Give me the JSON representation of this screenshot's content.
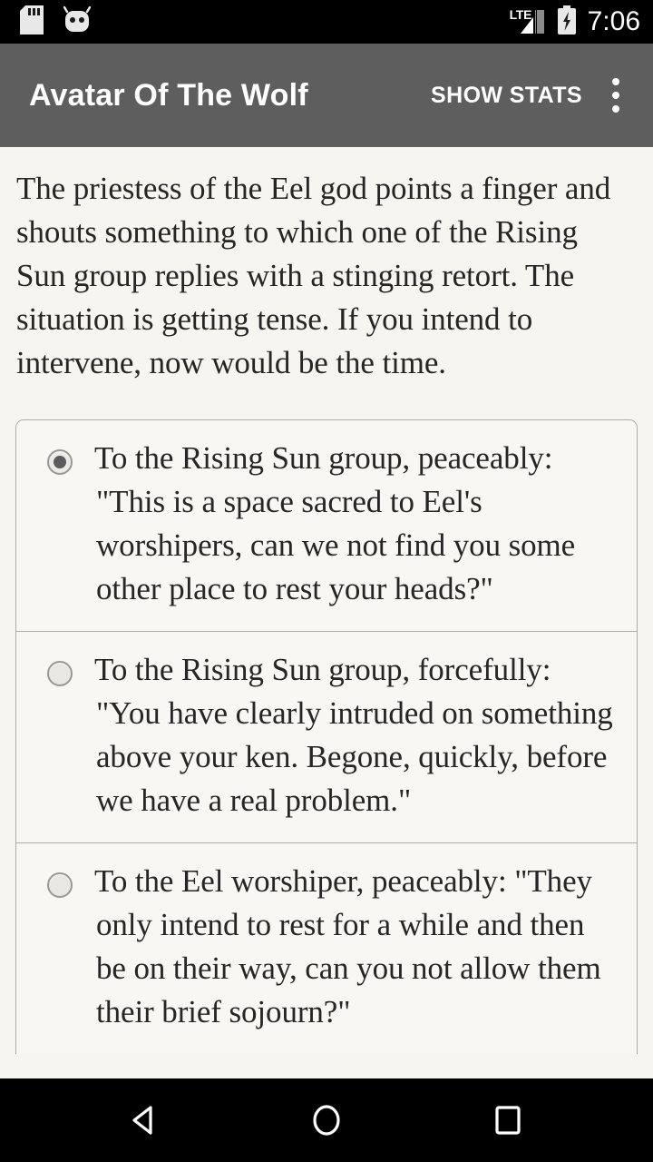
{
  "status_bar": {
    "icons": [
      "sd-card-icon",
      "android-head-icon"
    ],
    "network_label": "LTE",
    "signal_icon": "signal-bars-icon",
    "battery_icon": "battery-charging-icon",
    "time": "7:06"
  },
  "app_bar": {
    "title": "Avatar Of The Wolf",
    "show_stats_label": "SHOW STATS",
    "overflow_icon": "overflow-menu-icon"
  },
  "story": {
    "text": "The priestess of the Eel god points a finger and shouts something to which one of the Rising Sun group replies with a stinging retort. The situation is getting tense. If you intend to intervene, now would be the time."
  },
  "choices": [
    {
      "selected": true,
      "text": "To the Rising Sun group, peaceably: \"This is a space sacred to Eel's worshipers, can we not find you some other place to rest your heads?\""
    },
    {
      "selected": false,
      "text": "To the Rising Sun group, forcefully: \"You have clearly intruded on something above your ken. Begone, quickly, before we have a real problem.\""
    },
    {
      "selected": false,
      "text": "To the Eel worshiper, peaceably: \"They only intend to rest for a while and then be on their way, can you not allow them their brief sojourn?\""
    }
  ],
  "nav_bar": {
    "back_icon": "back-triangle-icon",
    "home_icon": "home-circle-icon",
    "recents_icon": "recents-square-icon"
  },
  "colors": {
    "status_bar_bg": "#000000",
    "app_bar_bg": "#5e5e5e",
    "page_bg": "#f7f5f0",
    "card_bg": "#f9f7f3",
    "card_border": "#b0aca6",
    "text": "#262626",
    "on_dark_text": "#ffffff"
  }
}
